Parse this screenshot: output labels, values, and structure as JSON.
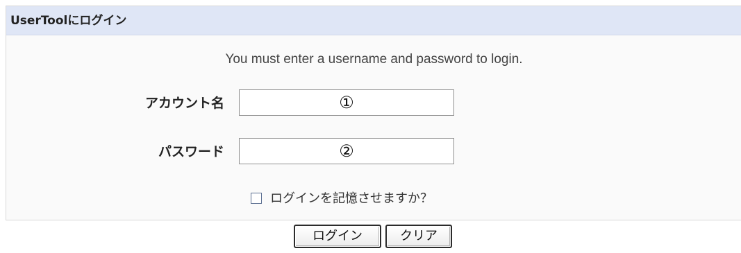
{
  "panel": {
    "title": "UserToolにログイン",
    "message": "You must enter a username and password to login."
  },
  "form": {
    "account_label": "アカウント名",
    "account_value": "①",
    "password_label": "パスワード",
    "password_value": "②",
    "remember_label": "ログインを記憶させますか？",
    "remember_checked": false
  },
  "buttons": {
    "login_label": "ログイン",
    "clear_label": "クリア"
  }
}
